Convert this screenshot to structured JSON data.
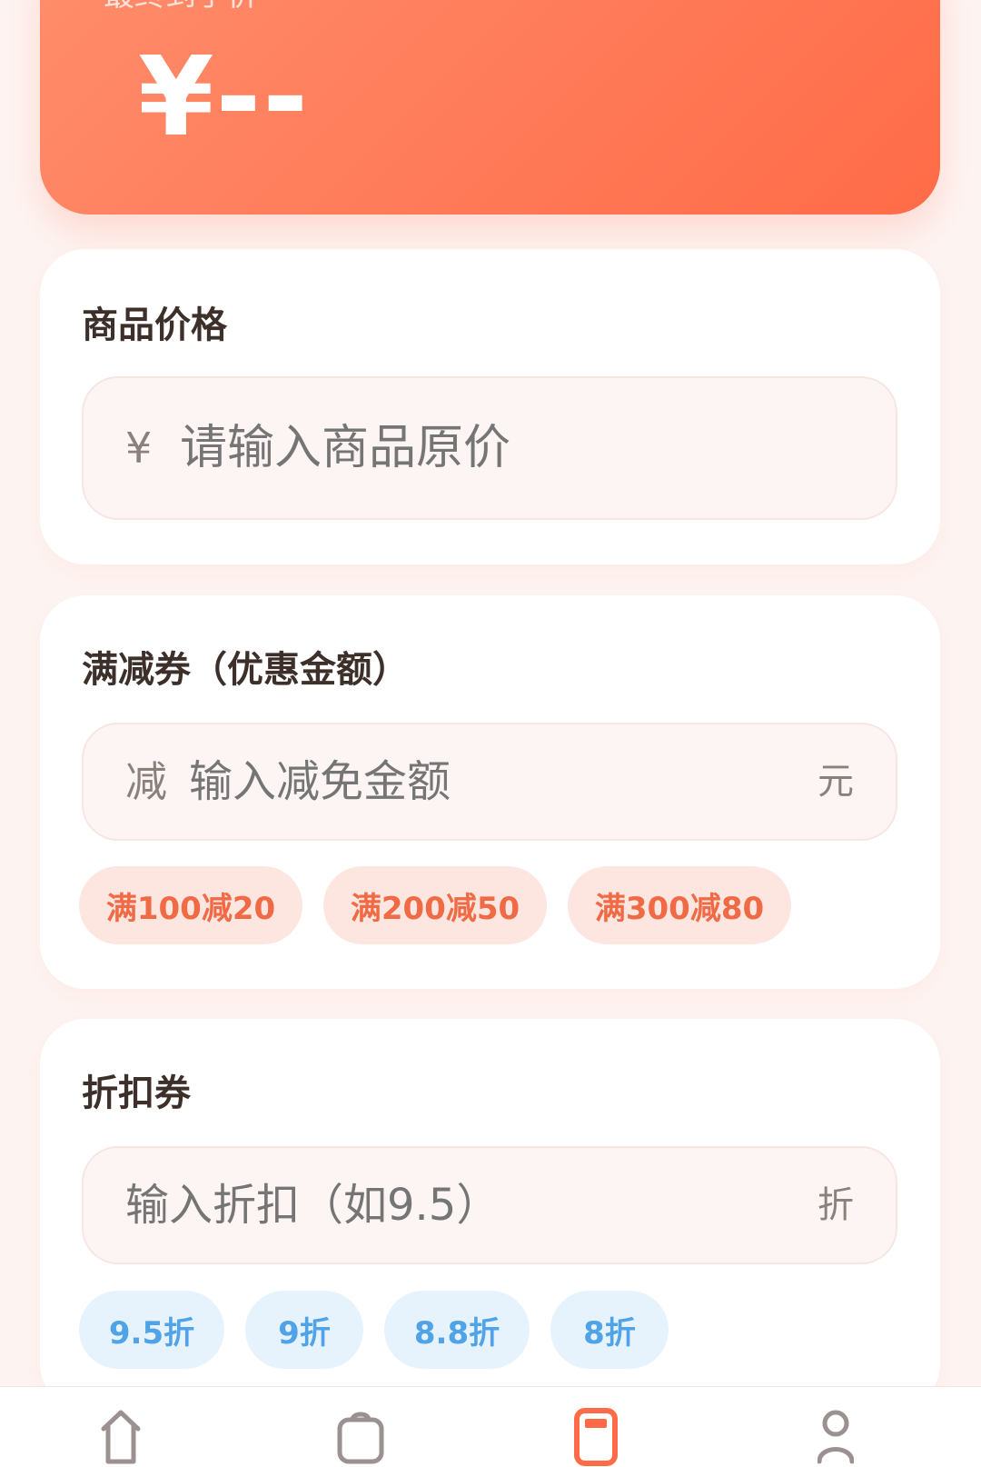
{
  "header": {
    "label": "最终到手价",
    "price": "¥--"
  },
  "price_section": {
    "title": "商品价格",
    "prefix": "¥",
    "placeholder": "请输入商品原价"
  },
  "coupon_section": {
    "title": "满减券（优惠金额）",
    "prefix": "减",
    "placeholder": "输入减免金额",
    "suffix": "元",
    "chips": [
      "满100减20",
      "满200减50",
      "满300减80"
    ]
  },
  "discount_section": {
    "title": "折扣券",
    "placeholder": "输入折扣（如9.5）",
    "suffix": "折",
    "chips": [
      "9.5折",
      "9折",
      "8.8折",
      "8折"
    ]
  },
  "bottom_nav": {
    "icons": [
      "home-icon",
      "bag-icon",
      "calculator-icon",
      "profile-icon"
    ],
    "active_color": "#ff6b47",
    "inactive_color": "#9a9190"
  },
  "colors": {
    "accent": "#ff7a58",
    "coupon_chip_text": "#f06a45",
    "discount_chip_text": "#4fa3e6"
  }
}
